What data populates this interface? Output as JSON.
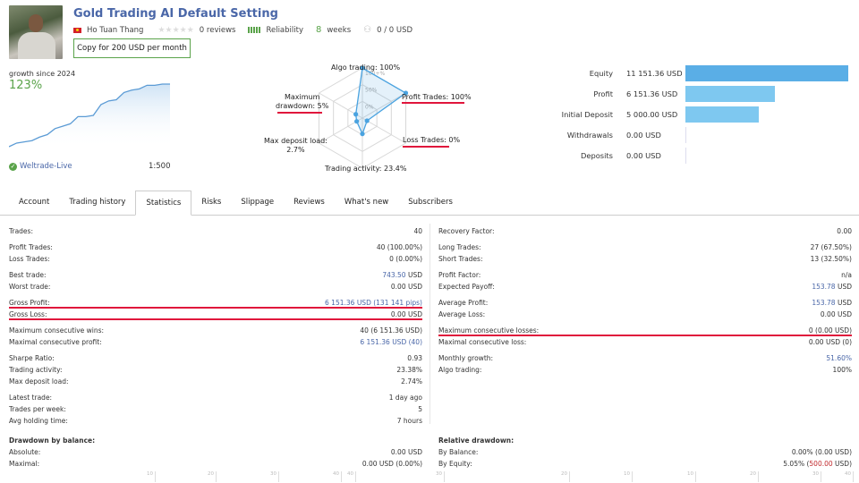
{
  "header": {
    "title": "Gold Trading AI Default Setting",
    "author": "Ho Tuan Thang",
    "reviews": "0 reviews",
    "reliability": "Reliability",
    "weeks_num": "8",
    "weeks_label": "weeks",
    "subscribers": "0 / 0 USD",
    "copy_button": "Copy for 200 USD per month",
    "stars": "★★★★★"
  },
  "growth": {
    "label": "growth since 2024",
    "value": "123%",
    "broker": "Weltrade-Live",
    "leverage": "1:500",
    "curve": [
      0,
      3,
      4,
      5,
      8,
      10,
      15,
      17,
      19,
      25,
      25,
      26,
      35,
      38,
      39,
      45,
      47,
      48,
      51,
      51,
      52,
      52
    ]
  },
  "radar": {
    "axes": [
      {
        "label": "Algo trading: 100%",
        "value": 100
      },
      {
        "label": "Profit Trades: 100%",
        "value": 100
      },
      {
        "label": "Loss Trades: 0%",
        "value": 0
      },
      {
        "label": "Trading activity: 23.4%",
        "value": 23.4
      },
      {
        "label": "Max deposit load: 2.7%",
        "value": 2.7
      },
      {
        "label": "Maximum drawdown: 5%",
        "value": 5
      }
    ],
    "label_max_drawdown_1": "Maximum",
    "label_max_drawdown_2": "drawdown: 5%",
    "label_deposit_1": "Max deposit load:",
    "label_deposit_2": "2.7%",
    "ring_labels": [
      "100+%",
      "50%",
      "0%"
    ],
    "color": "#4aa3e0"
  },
  "balance": [
    {
      "label": "Equity",
      "value": "11 151.36 USD",
      "amount": 11151.36
    },
    {
      "label": "Profit",
      "value": "6 151.36 USD",
      "amount": 6151.36
    },
    {
      "label": "Initial Deposit",
      "value": "5 000.00 USD",
      "amount": 5000
    },
    {
      "label": "Withdrawals",
      "value": "0.00 USD",
      "amount": 0
    },
    {
      "label": "Deposits",
      "value": "0.00 USD",
      "amount": 0
    }
  ],
  "tabs": [
    "Account",
    "Trading history",
    "Statistics",
    "Risks",
    "Slippage",
    "Reviews",
    "What's new",
    "Subscribers"
  ],
  "active_tab": "Statistics",
  "stats_left": [
    [
      {
        "k": "Trades:",
        "v": "40"
      }
    ],
    [
      {
        "k": "Profit Trades:",
        "v": "40 (100.00%)"
      },
      {
        "k": "Loss Trades:",
        "v": "0 (0.00%)"
      }
    ],
    [
      {
        "k": "Best trade:",
        "v": "743.50",
        "u": " USD",
        "blue": true
      },
      {
        "k": "Worst trade:",
        "v": "0.00 USD"
      }
    ],
    [
      {
        "k": "Gross Profit:",
        "v": "6 151.36 USD (131 141 pips)",
        "blue": true,
        "underline": true
      },
      {
        "k": "Gross Loss:",
        "v": "0.00 USD",
        "underline": true
      }
    ],
    [
      {
        "k": "Maximum consecutive wins:",
        "v": "40 (6 151.36 USD)"
      },
      {
        "k": "Maximal consecutive profit:",
        "v": "6 151.36 USD (40)",
        "blue": true
      }
    ],
    [
      {
        "k": "Sharpe Ratio:",
        "v": "0.93"
      },
      {
        "k": "Trading activity:",
        "v": "23.38%"
      },
      {
        "k": "Max deposit load:",
        "v": "2.74%"
      }
    ],
    [
      {
        "k": "Latest trade:",
        "v": "1 day ago"
      },
      {
        "k": "Trades per week:",
        "v": "5"
      },
      {
        "k": "Avg holding time:",
        "v": "7 hours"
      }
    ]
  ],
  "stats_right": [
    [
      {
        "k": "Recovery Factor:",
        "v": "0.00"
      }
    ],
    [
      {
        "k": "Long Trades:",
        "v": "27 (67.50%)"
      },
      {
        "k": "Short Trades:",
        "v": "13 (32.50%)"
      }
    ],
    [
      {
        "k": "Profit Factor:",
        "v": "n/a"
      },
      {
        "k": "Expected Payoff:",
        "v": "153.78",
        "u": " USD",
        "blue": true
      }
    ],
    [
      {
        "k": "Average Profit:",
        "v": "153.78",
        "u": " USD",
        "blue": true
      },
      {
        "k": "Average Loss:",
        "v": "0.00 USD"
      }
    ],
    [
      {
        "k": "Maximum consecutive losses:",
        "v": "0 (0.00 USD)",
        "underline": true
      },
      {
        "k": "Maximal consecutive loss:",
        "v": "0.00 USD (0)"
      }
    ],
    [
      {
        "k": "Monthly growth:",
        "v": "51.60%",
        "blue": true
      },
      {
        "k": "Algo trading:",
        "v": "100%"
      }
    ]
  ],
  "drawdown_balance": {
    "title": "Drawdown by balance:",
    "rows": [
      {
        "k": "Absolute:",
        "v": "0.00 USD"
      },
      {
        "k": "Maximal:",
        "v": "0.00 USD (0.00%)"
      }
    ]
  },
  "relative_drawdown": {
    "title": "Relative drawdown:",
    "rows": [
      {
        "k": "By Balance:",
        "v": "0.00% (0.00 USD)"
      },
      {
        "k": "By Equity:",
        "v": "5.05% (",
        "v2": "500.00",
        "v3": " USD)"
      }
    ]
  },
  "bottom_ticks": [
    "10",
    "20",
    "30",
    "40",
    "40",
    "30",
    "20",
    "10",
    "10",
    "20",
    "30",
    "40"
  ]
}
